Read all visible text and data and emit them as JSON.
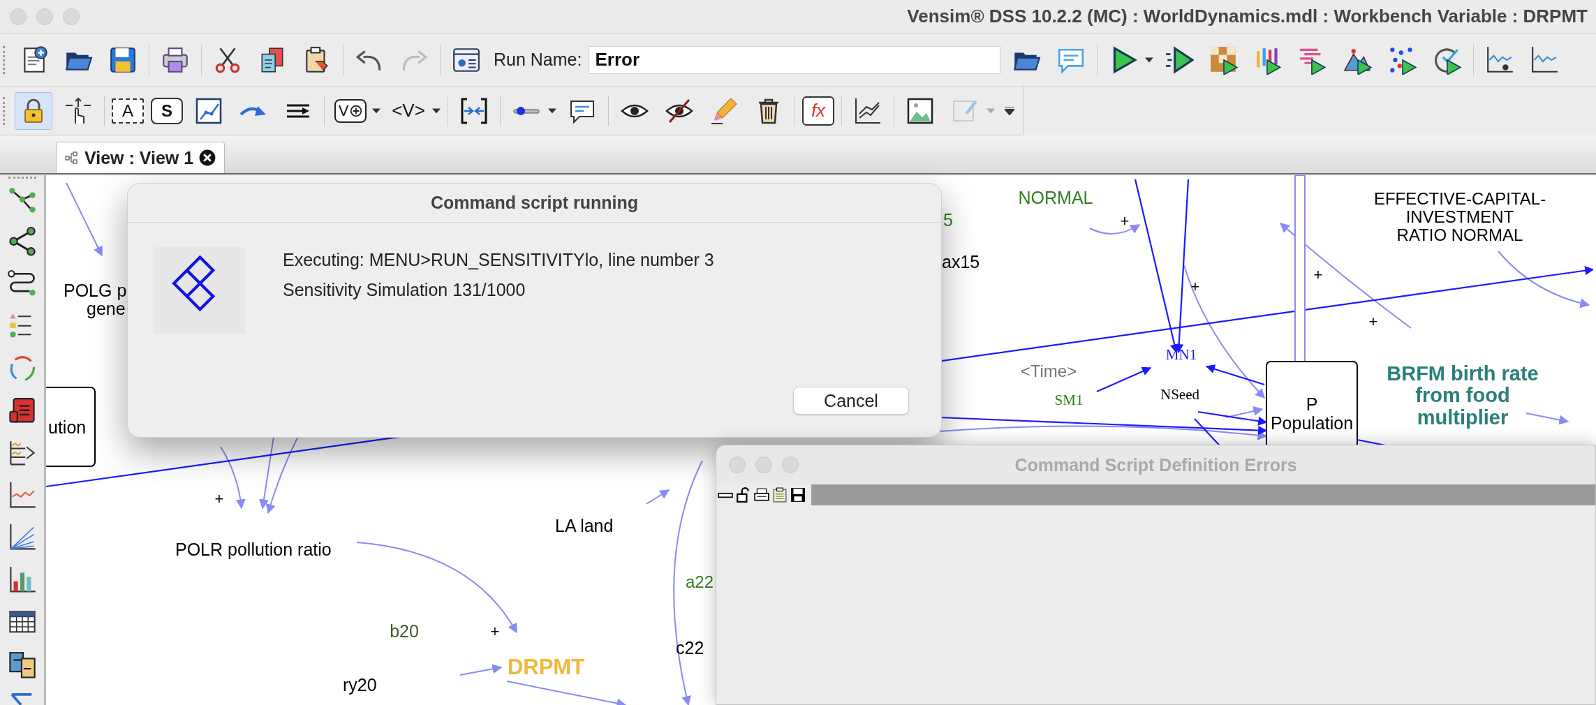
{
  "window": {
    "title": "Vensim® DSS 10.2.2 (MC) : WorldDynamics.mdl : Workbench Variable : DRPMT"
  },
  "toolbar": {
    "run_name_label": "Run Name:",
    "run_name_value": "Error"
  },
  "sketch_toolbar": {
    "lock_tool": {
      "selected": true
    },
    "text_tool": "A",
    "stock_tool": "S",
    "variable_tool": "V",
    "shadow_tool": "<V>",
    "function_tool": "fx"
  },
  "tabs": [
    {
      "label": "View : View 1",
      "selected": true
    }
  ],
  "diagram": {
    "labels": [
      {
        "kind": "label",
        "lines": [
          "NORMAL"
        ],
        "color": "#2f7d1c"
      },
      {
        "kind": "label",
        "lines": [
          "5"
        ],
        "color": "#2f7d1c"
      },
      {
        "kind": "label",
        "lines": [
          "ax15"
        ],
        "color": "#000000"
      },
      {
        "kind": "label",
        "lines": [
          "EFFECTIVE-CAPITAL-",
          "INVESTMENT",
          "RATIO NORMAL"
        ],
        "color": "#000000"
      },
      {
        "kind": "label",
        "lines": [
          "POLG p"
        ],
        "color": "#000000"
      },
      {
        "kind": "label",
        "lines": [
          "gene"
        ],
        "color": "#000000"
      },
      {
        "kind": "label",
        "lines": [
          "<Time>"
        ],
        "color": "#777777"
      },
      {
        "kind": "serif_label",
        "lines": [
          "MN1"
        ],
        "color": "#1a1aff"
      },
      {
        "kind": "serif_label",
        "lines": [
          "SM1"
        ],
        "color": "#2f7d1c"
      },
      {
        "kind": "serif_label",
        "lines": [
          "NSeed"
        ],
        "color": "#000000"
      },
      {
        "kind": "label",
        "lines": [
          "BRFM birth rate",
          "from food",
          "multiplier"
        ],
        "color": "#2a7f7a"
      },
      {
        "kind": "label",
        "lines": [
          "LA land"
        ],
        "color": "#000000"
      },
      {
        "kind": "label",
        "lines": [
          "POLR pollution ratio"
        ],
        "color": "#000000"
      },
      {
        "kind": "label",
        "lines": [
          "a22"
        ],
        "color": "#2f7d1c"
      },
      {
        "kind": "label",
        "lines": [
          "c22"
        ],
        "color": "#000000"
      },
      {
        "kind": "label",
        "lines": [
          "b20"
        ],
        "color": "#3d5c2a"
      },
      {
        "kind": "label",
        "lines": [
          "ry20"
        ],
        "color": "#000000"
      },
      {
        "kind": "label",
        "lines": [
          "DRPMT"
        ],
        "color": "#f0b83c"
      },
      {
        "kind": "sign",
        "lines": [
          "+"
        ],
        "color": "#000000"
      },
      {
        "kind": "sign",
        "lines": [
          "+"
        ],
        "color": "#000000"
      },
      {
        "kind": "sign",
        "lines": [
          "+"
        ],
        "color": "#000000"
      },
      {
        "kind": "sign",
        "lines": [
          "+"
        ],
        "color": "#000000"
      },
      {
        "kind": "sign",
        "lines": [
          "+"
        ],
        "color": "#000000"
      },
      {
        "kind": "sign",
        "lines": [
          "+"
        ],
        "color": "#000000"
      }
    ],
    "stocks": [
      {
        "lines": [
          "ution"
        ]
      },
      {
        "lines": [
          "P",
          "Population"
        ]
      }
    ]
  },
  "dialog": {
    "title": "Command script running",
    "lines": [
      "Executing: MENU>RUN_SENSITIVITYlo, line number 3",
      "Sensitivity Simulation 131/1000"
    ],
    "button": "Cancel"
  },
  "errors_window": {
    "title": "Command Script Definition Errors"
  }
}
